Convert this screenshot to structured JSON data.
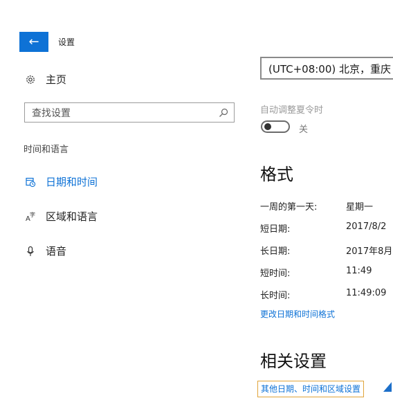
{
  "window": {
    "title": "设置",
    "back_icon": "arrow-left-icon"
  },
  "sidebar": {
    "home_label": "主页",
    "search_placeholder": "查找设置",
    "section_heading": "时间和语言",
    "items": [
      {
        "label": "日期和时间",
        "icon": "date-time-icon",
        "selected": true
      },
      {
        "label": "区域和语言",
        "icon": "region-language-icon",
        "selected": false
      },
      {
        "label": "语音",
        "icon": "microphone-icon",
        "selected": false
      }
    ]
  },
  "main": {
    "timezone_value": "(UTC+08:00) 北京，重庆",
    "dst_label": "自动调整夏令时",
    "dst_state": "关",
    "format_heading": "格式",
    "format_rows": [
      {
        "key": "一周的第一天:",
        "value": "星期一"
      },
      {
        "key": "短日期:",
        "value": "2017/8/2"
      },
      {
        "key": "长日期:",
        "value": "2017年8月"
      },
      {
        "key": "短时间:",
        "value": "11:49"
      },
      {
        "key": "长时间:",
        "value": "11:49:09"
      }
    ],
    "change_format_link": "更改日期和时间格式",
    "related_heading": "相关设置",
    "related_link": "其他日期、时间和区域设置"
  },
  "colors": {
    "accent": "#0e72d6",
    "highlight_border": "#e0a43a"
  }
}
